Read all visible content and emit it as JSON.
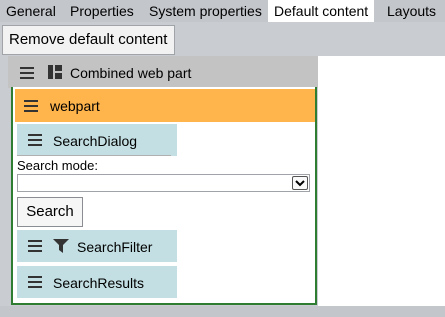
{
  "tabs": [
    {
      "label": "General",
      "active": false
    },
    {
      "label": "Properties",
      "active": false
    },
    {
      "label": "System properties",
      "active": false
    },
    {
      "label": "Default content",
      "active": true
    },
    {
      "label": "Layouts",
      "active": false
    }
  ],
  "toolbar": {
    "remove_label": "Remove default content"
  },
  "combined": {
    "title": "Combined web part",
    "icon": "layout-icon"
  },
  "webpart": {
    "title": "webpart"
  },
  "search_dialog": {
    "title": "SearchDialog"
  },
  "search_mode": {
    "label": "Search mode:",
    "selected": ""
  },
  "search_button": {
    "label": "Search"
  },
  "search_filter": {
    "title": "SearchFilter",
    "icon": "filter-icon"
  },
  "search_results": {
    "title": "SearchResults"
  },
  "colors": {
    "webpart_bar": "#ffb44c",
    "widget_bg": "#c3dfe3",
    "content_border": "#2e7d32",
    "header_bg": "#c3c3c3"
  }
}
